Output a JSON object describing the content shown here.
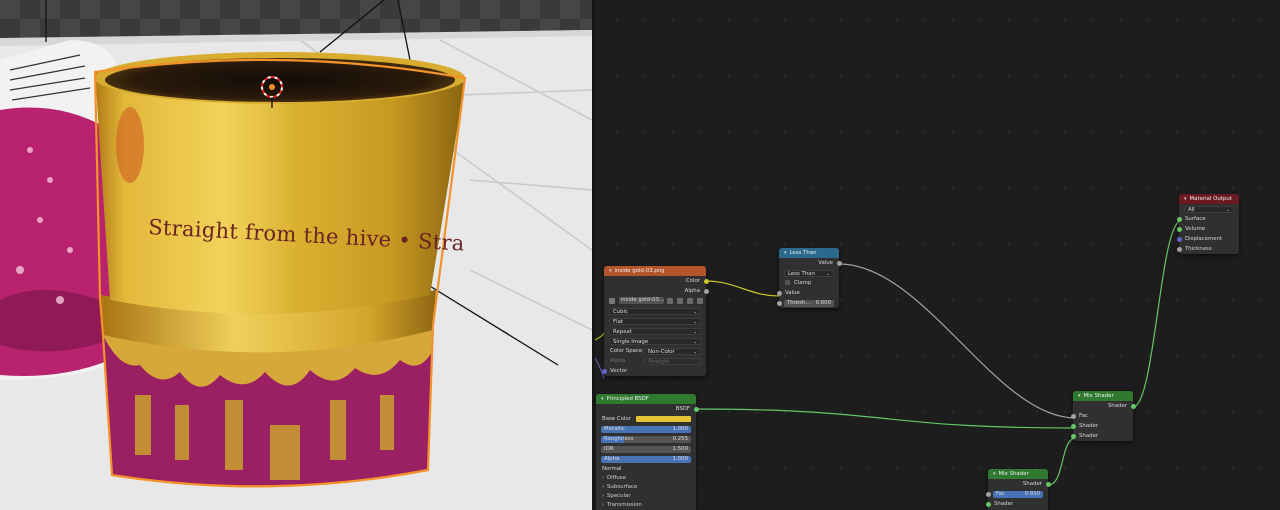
{
  "viewport": {
    "can_print_text": "Straight from the hive • Stra",
    "colors": {
      "gold": "#d9b030",
      "gold_dark": "#8a6a12",
      "band": "#9a1f63",
      "selection": "#f3922a",
      "floor": "#e8e8e8"
    }
  },
  "node_editor": {
    "image_texture": {
      "title": "inside gold-03.png",
      "outputs": [
        "Color",
        "Alpha"
      ],
      "image_name": "inside gold-03...",
      "interpolation": "Cubic",
      "projection": "Flat",
      "extension": "Repeat",
      "source": "Single Image",
      "color_space_label": "Color Space",
      "color_space_value": "Non-Color",
      "alpha_label": "Alpha",
      "alpha_value": "Straight",
      "vector_label": "Vector"
    },
    "less_than": {
      "title": "Less Than",
      "output": "Value",
      "operation": "Less Than",
      "clamp_label": "Clamp",
      "input_label": "Value",
      "threshold_label": "Thresh...",
      "threshold_value": "0.600"
    },
    "principled": {
      "title": "Principled BSDF",
      "output": "BSDF",
      "base_color_label": "Base Color",
      "metallic_label": "Metallic",
      "metallic_value": "1.000",
      "roughness_label": "Roughness",
      "roughness_value": "0.255",
      "ior_label": "IOR",
      "ior_value": "1.500",
      "alpha_label": "Alpha",
      "alpha_value": "1.000",
      "normal_label": "Normal",
      "panels": [
        "Diffuse",
        "Subsurface",
        "Specular",
        "Transmission"
      ]
    },
    "mix_shader_1": {
      "title": "Mix Shader",
      "output": "Shader",
      "inputs": [
        "Fac",
        "Shader",
        "Shader"
      ]
    },
    "mix_shader_2": {
      "title": "Mix Shader",
      "output": "Shader",
      "fac_label": "Fac",
      "fac_value": "0.930",
      "input_shader": "Shader"
    },
    "material_output": {
      "title": "Material Output",
      "target": "All",
      "inputs": [
        "Surface",
        "Volume",
        "Displacement",
        "Thickness"
      ]
    }
  }
}
